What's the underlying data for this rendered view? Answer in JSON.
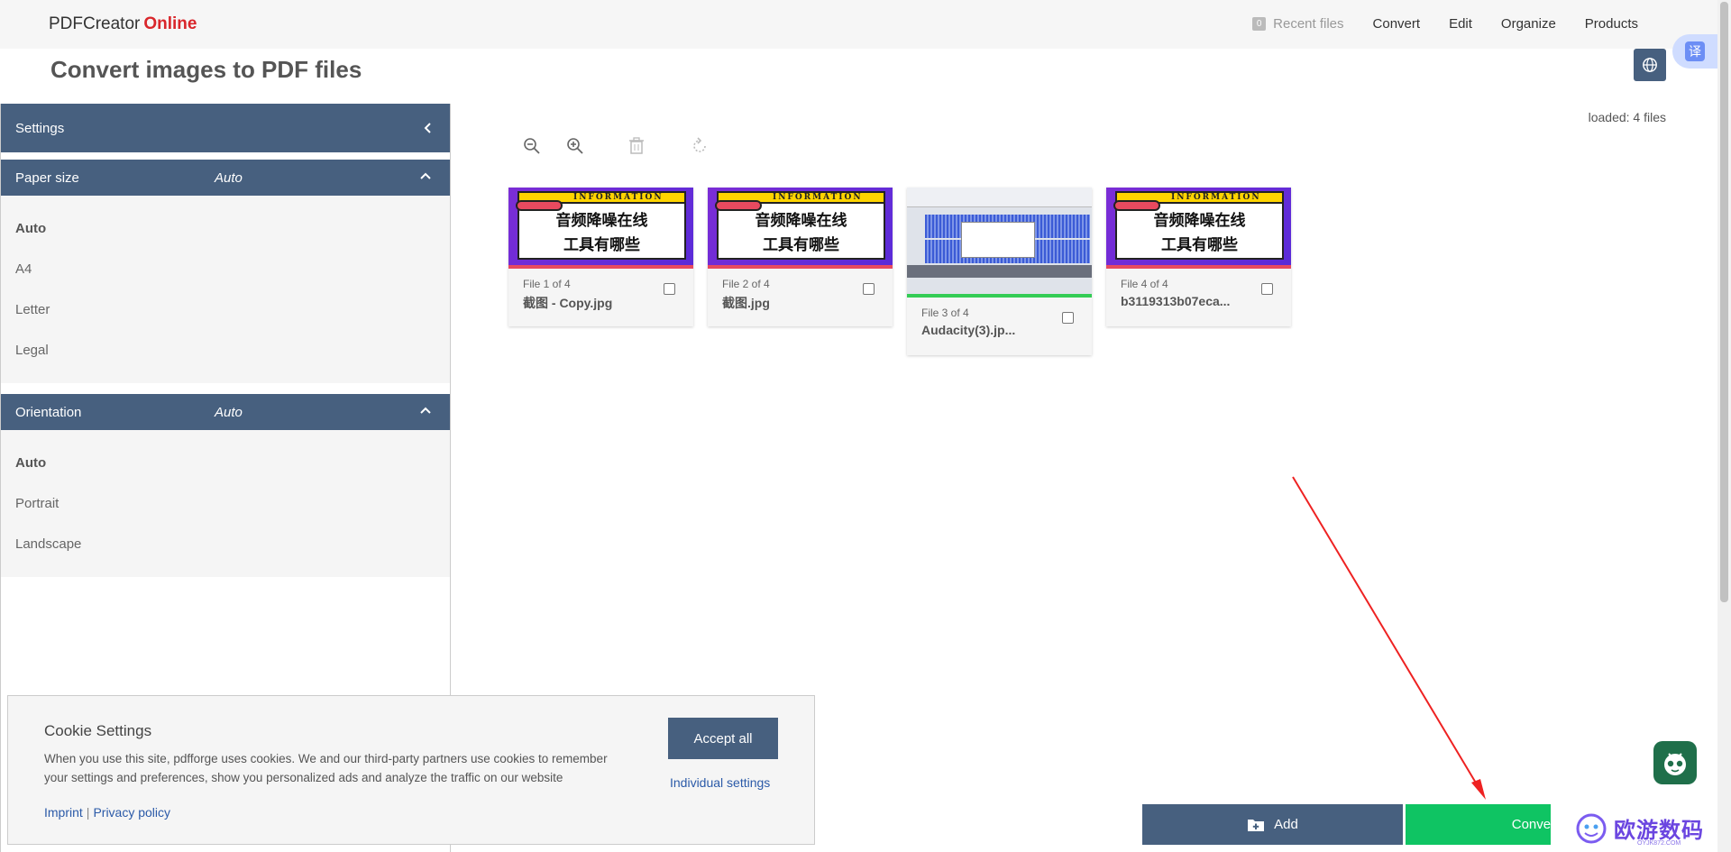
{
  "brand": {
    "name": "PDFCreator",
    "accent": "Online",
    "accent_color": "#d9262b"
  },
  "nav": {
    "recent_badge": "0",
    "recent": "Recent files",
    "items": [
      "Convert",
      "Edit",
      "Organize",
      "Products"
    ]
  },
  "page_title": "Convert images to PDF files",
  "translate_icon": "译",
  "sidebar": {
    "title": "Settings",
    "paper_size": {
      "label": "Paper size",
      "value": "Auto",
      "options": [
        "Auto",
        "A4",
        "Letter",
        "Legal"
      ]
    },
    "orientation": {
      "label": "Orientation",
      "value": "Auto",
      "options": [
        "Auto",
        "Portrait",
        "Landscape"
      ]
    }
  },
  "main": {
    "loaded": "loaded: 4 files",
    "thumb_banner": "INFORMATION",
    "thumb_line1": "音频降噪在线",
    "thumb_line2": "工具有哪些",
    "files": [
      {
        "index": "File 1 of 4",
        "name": "截图 - Copy.jpg"
      },
      {
        "index": "File 2 of 4",
        "name": "截图.jpg"
      },
      {
        "index": "File 3 of 4",
        "name": "Audacity(3).jp..."
      },
      {
        "index": "File 4 of 4",
        "name": "b3119313b07eca..."
      }
    ]
  },
  "cookie": {
    "title": "Cookie Settings",
    "text": "When you use this site, pdfforge uses cookies. We and our third-party partners use cookies to remember your settings and preferences, show you personalized ads and analyze the traffic on our website",
    "imprint": "Imprint",
    "separator": "|",
    "privacy": "Privacy policy",
    "accept": "Accept all",
    "individual": "Individual settings"
  },
  "actions": {
    "add": "Add",
    "convert": "Convert"
  },
  "watermark": {
    "text": "欧游数码",
    "sub": "OYJK872.COM"
  },
  "colors": {
    "primary": "#47607f",
    "convert": "#0fc463",
    "arrow": "#ee2222"
  }
}
